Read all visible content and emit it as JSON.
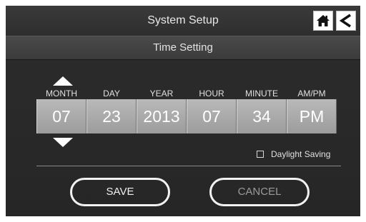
{
  "header": {
    "title": "System Setup"
  },
  "subheader": {
    "title": "Time Setting"
  },
  "fields": [
    {
      "label": "MONTH",
      "value": "07"
    },
    {
      "label": "DAY",
      "value": "23"
    },
    {
      "label": "YEAR",
      "value": "2013"
    },
    {
      "label": "HOUR",
      "value": "07"
    },
    {
      "label": "MINUTE",
      "value": "34"
    },
    {
      "label": "AM/PM",
      "value": "PM"
    }
  ],
  "daylight_saving": {
    "label": "Daylight Saving",
    "checked": false
  },
  "buttons": {
    "save": "SAVE",
    "cancel": "CANCEL"
  },
  "icons": {
    "home": "home-icon",
    "back": "back-arrow-icon",
    "up": "up-arrow-icon",
    "down": "down-arrow-icon"
  }
}
